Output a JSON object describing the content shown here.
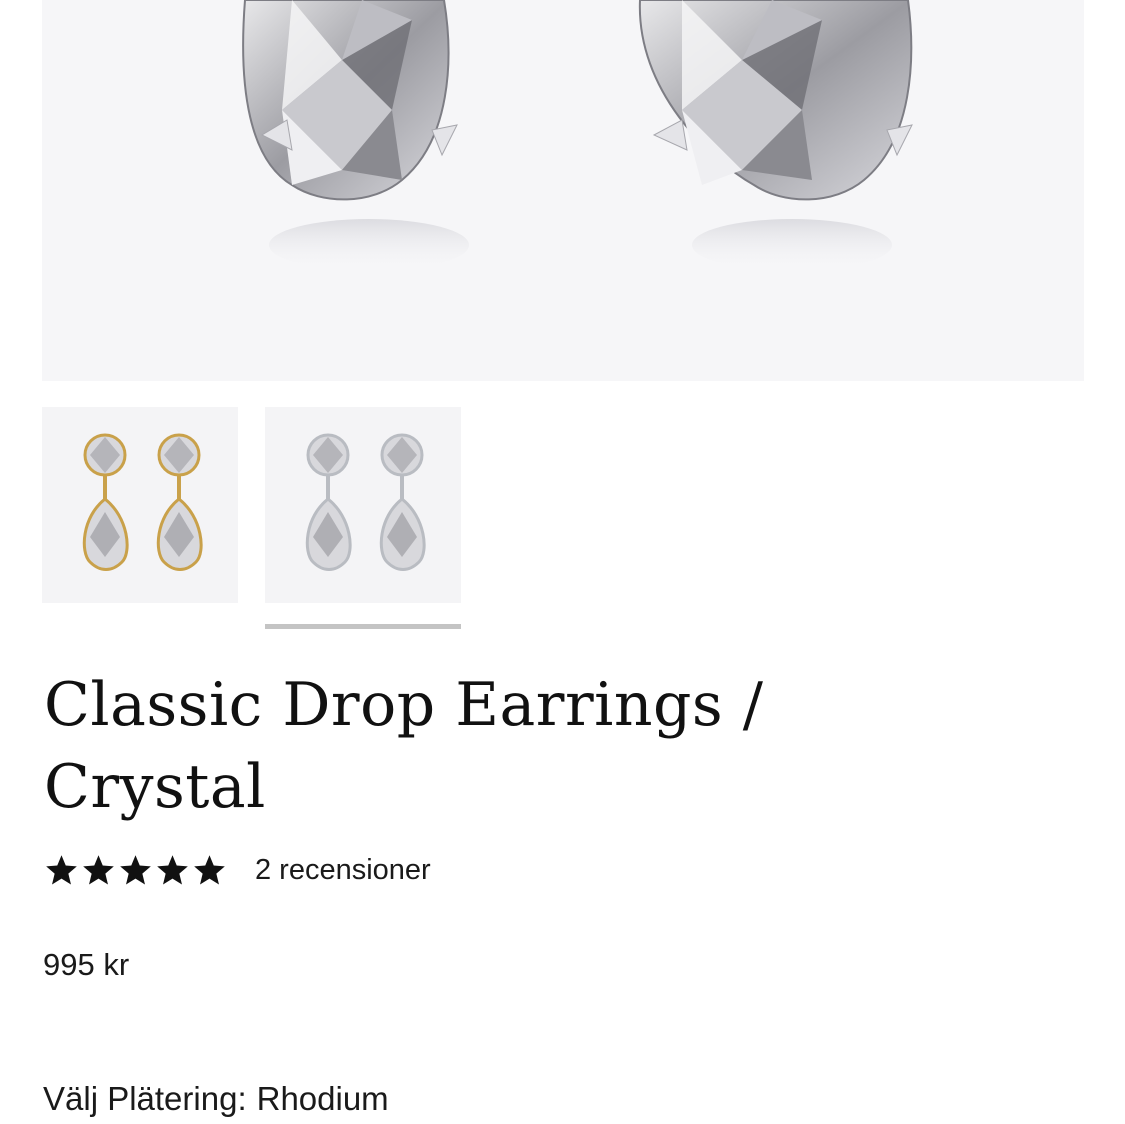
{
  "product": {
    "title": "Classic Drop Earrings / Crystal",
    "rating": 5,
    "rating_max": 5,
    "reviews_label": "2 recensioner",
    "price": "995 kr"
  },
  "gallery": {
    "main_image": "crystal-pear-earrings-closeup",
    "thumbnails": [
      {
        "icon": "gold-drop-earrings-thumbnail",
        "metal_color": "#c9a14a",
        "selected": false
      },
      {
        "icon": "rhodium-drop-earrings-thumbnail",
        "metal_color": "#b9bcc2",
        "selected": true
      }
    ]
  },
  "plating": {
    "label": "Välj Plätering:",
    "value": "Rhodium"
  },
  "icons": {
    "star": "star-icon"
  },
  "colors": {
    "text": "#111111",
    "hero_bg": "#f6f6f8",
    "thumb_bg": "#f4f4f6",
    "indicator": "#c4c4c4"
  }
}
